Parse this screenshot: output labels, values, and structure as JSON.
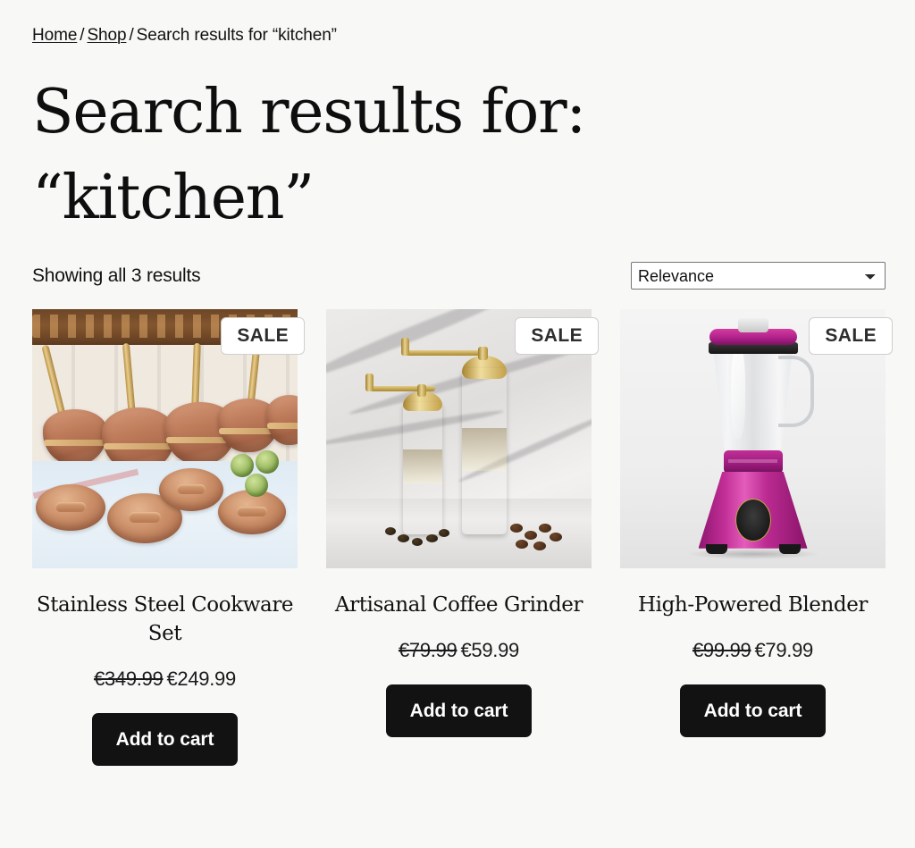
{
  "breadcrumb": {
    "home_label": "Home",
    "shop_label": "Shop",
    "separator": "/",
    "current_label": "Search results for “kitchen”"
  },
  "page_title": "Search results for: “kitchen”",
  "results": {
    "count_text": "Showing all 3 results",
    "sort": {
      "selected": "Relevance",
      "options": [
        "Relevance"
      ]
    }
  },
  "products": [
    {
      "badge": "SALE",
      "title": "Stainless Steel Cookware Set",
      "price_old": "€349.99",
      "price_new": "€249.99",
      "add_to_cart_label": "Add to cart",
      "image_alt": "copper-cookware-set-photo"
    },
    {
      "badge": "SALE",
      "title": "Artisanal Coffee Grinder",
      "price_old": "€79.99",
      "price_new": "€59.99",
      "add_to_cart_label": "Add to cart",
      "image_alt": "brass-coffee-grinder-photo"
    },
    {
      "badge": "SALE",
      "title": "High-Powered Blender",
      "price_old": "€99.99",
      "price_new": "€79.99",
      "add_to_cart_label": "Add to cart",
      "image_alt": "magenta-blender-photo"
    }
  ],
  "colors": {
    "page_background": "#f8f8f7",
    "text": "#111111",
    "button_background": "#121212",
    "button_text": "#ffffff",
    "badge_background": "#ffffff",
    "badge_text": "#2d2d2d"
  }
}
